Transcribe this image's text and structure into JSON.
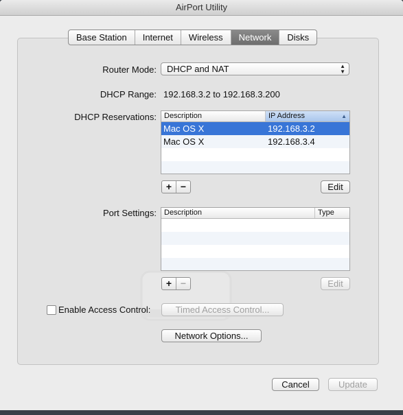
{
  "window": {
    "title": "AirPort Utility"
  },
  "tabs": [
    {
      "label": "Base Station"
    },
    {
      "label": "Internet"
    },
    {
      "label": "Wireless"
    },
    {
      "label": "Network",
      "active": true
    },
    {
      "label": "Disks"
    }
  ],
  "router_mode": {
    "label": "Router Mode:",
    "value": "DHCP and NAT"
  },
  "dhcp_range": {
    "label": "DHCP Range:",
    "value": "192.168.3.2 to 192.168.3.200"
  },
  "reservations": {
    "label": "DHCP Reservations:",
    "columns": [
      "Description",
      "IP Address"
    ],
    "rows": [
      {
        "description": "Mac OS X",
        "ip": "192.168.3.2",
        "selected": true
      },
      {
        "description": "Mac OS X",
        "ip": "192.168.3.4",
        "selected": false
      }
    ],
    "add": "+",
    "remove": "−",
    "edit_label": "Edit"
  },
  "ports": {
    "label": "Port Settings:",
    "columns": [
      "Description",
      "Type"
    ],
    "add": "+",
    "remove": "−",
    "edit_label": "Edit"
  },
  "access_control": {
    "checkbox_label": "Enable Access Control:",
    "checked": false,
    "timed_button": "Timed Access Control..."
  },
  "network_options_button": "Network Options...",
  "footer": {
    "cancel": "Cancel",
    "update": "Update"
  },
  "colors": {
    "selection": "#3875d7",
    "active_tab": "#7a7a7a"
  }
}
